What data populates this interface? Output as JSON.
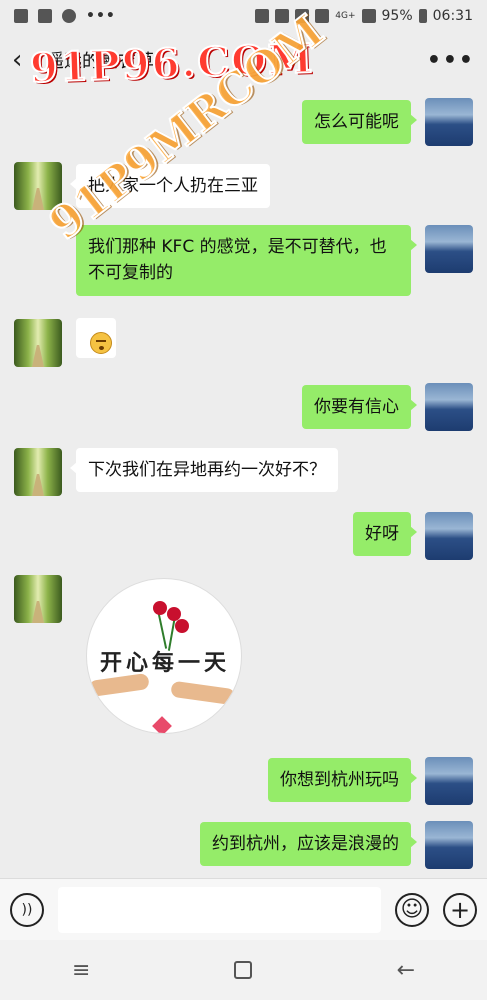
{
  "statusbar": {
    "battery": "95%",
    "time": "06:31",
    "network": "4G+",
    "more": "•••"
  },
  "header": {
    "back": "‹",
    "title": "遥远的薰衣草",
    "more": "•••"
  },
  "watermarks": [
    "91P96.COM",
    "91P9MRCOM"
  ],
  "messages": [
    {
      "from": "me",
      "text": "怎么可能呢"
    },
    {
      "from": "them",
      "text": "把人家一个人扔在三亚"
    },
    {
      "from": "me",
      "text": "我们那种 KFC 的感觉，是不可替代，也不可复制的"
    },
    {
      "from": "them",
      "type": "emoji"
    },
    {
      "from": "me",
      "text": "你要有信心"
    },
    {
      "from": "them",
      "text": "下次我们在异地再约一次好不？"
    },
    {
      "from": "me",
      "text": "好呀"
    },
    {
      "from": "them",
      "type": "sticker",
      "text": "开心每一天"
    },
    {
      "from": "me",
      "text": "你想到杭州玩吗"
    },
    {
      "from": "me",
      "text": "约到杭州，应该是浪漫的"
    }
  ],
  "inputbar": {
    "voice_icon": "voice-icon",
    "emoji_icon": "emoji-icon",
    "plus_icon": "plus-icon",
    "voice": "))",
    "emoji": "☺",
    "plus": "+"
  },
  "navbar": {
    "recent": "≡",
    "back": "←"
  }
}
